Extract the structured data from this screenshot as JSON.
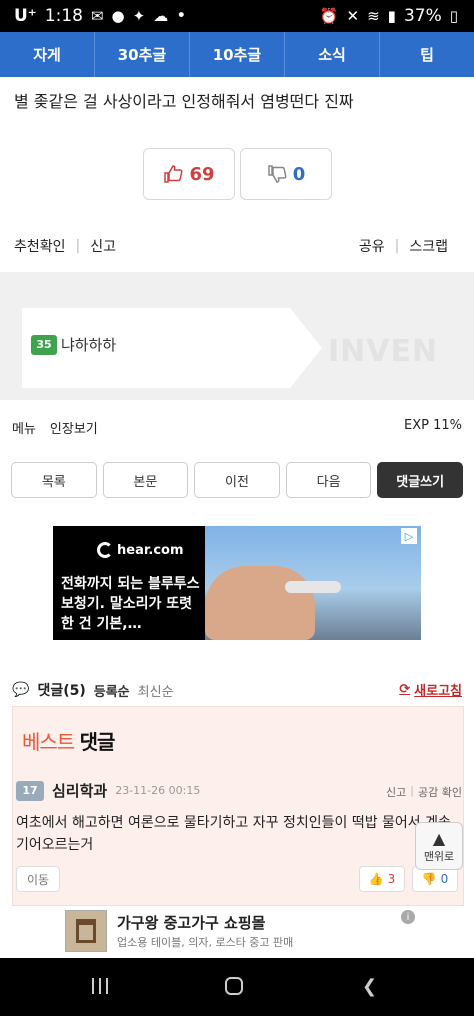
{
  "status_bar": {
    "carrier": "U⁺",
    "time": "1:18",
    "dot": "•",
    "battery": "37%",
    "left_icons": [
      "message-icon",
      "pill-icon",
      "gamepad-icon",
      "cloud-icon"
    ],
    "right_icons": [
      "alarm-icon",
      "mute-icon",
      "wifi-icon",
      "signal-icon",
      "battery-icon"
    ]
  },
  "nav": {
    "items": [
      "자게",
      "30추글",
      "10추글",
      "소식",
      "팁"
    ]
  },
  "post": {
    "title": "별 좆같은 걸 사상이라고 인정해줘서 염병떤다 진짜",
    "upvotes": "69",
    "downvotes": "0",
    "recommend_check": "추천확인",
    "report": "신고",
    "share": "공유",
    "scrap": "스크랩"
  },
  "profile": {
    "level": "35",
    "nickname": "냐하하하",
    "brand": "INVEN",
    "menu": "메뉴",
    "emblem": "인장보기",
    "exp": "EXP 11%"
  },
  "buttons": {
    "list": "목록",
    "body": "본문",
    "prev": "이전",
    "next": "다음",
    "write_comment": "댓글쓰기"
  },
  "ad": {
    "logo": "hear.com",
    "text": "전화까지 되는 블루투스 보청기. 말소리가 또렷한 건 기본,…",
    "badge": "▷"
  },
  "comments": {
    "label": "댓글",
    "count": "(5)",
    "sort_registered": "등록순",
    "sort_latest": "최신순",
    "refresh": "새로고침",
    "best_label_red": "베스트",
    "best_label_black": "댓글",
    "items": [
      {
        "level": "17",
        "name": "심리학과",
        "date": "23-11-26 00:15",
        "report": "신고",
        "agree": "공감 확인",
        "text": "여초에서 해고하면 여론으로 물타기하고 자꾸 정치인들이 떡밥 물어서 계속 기어오르는거",
        "move": "이동",
        "up": "3",
        "down": "0"
      }
    ]
  },
  "fab": {
    "label": "맨위로"
  },
  "bottom_ad": {
    "title": "가구왕 중고가구 쇼핑몰",
    "subtitle": "업소용 테이블, 의자, 로스타 중고 판매"
  },
  "colors": {
    "nav_blue": "#2d6ecb",
    "up_red": "#d04040",
    "best_bg": "#fdf0ec"
  }
}
